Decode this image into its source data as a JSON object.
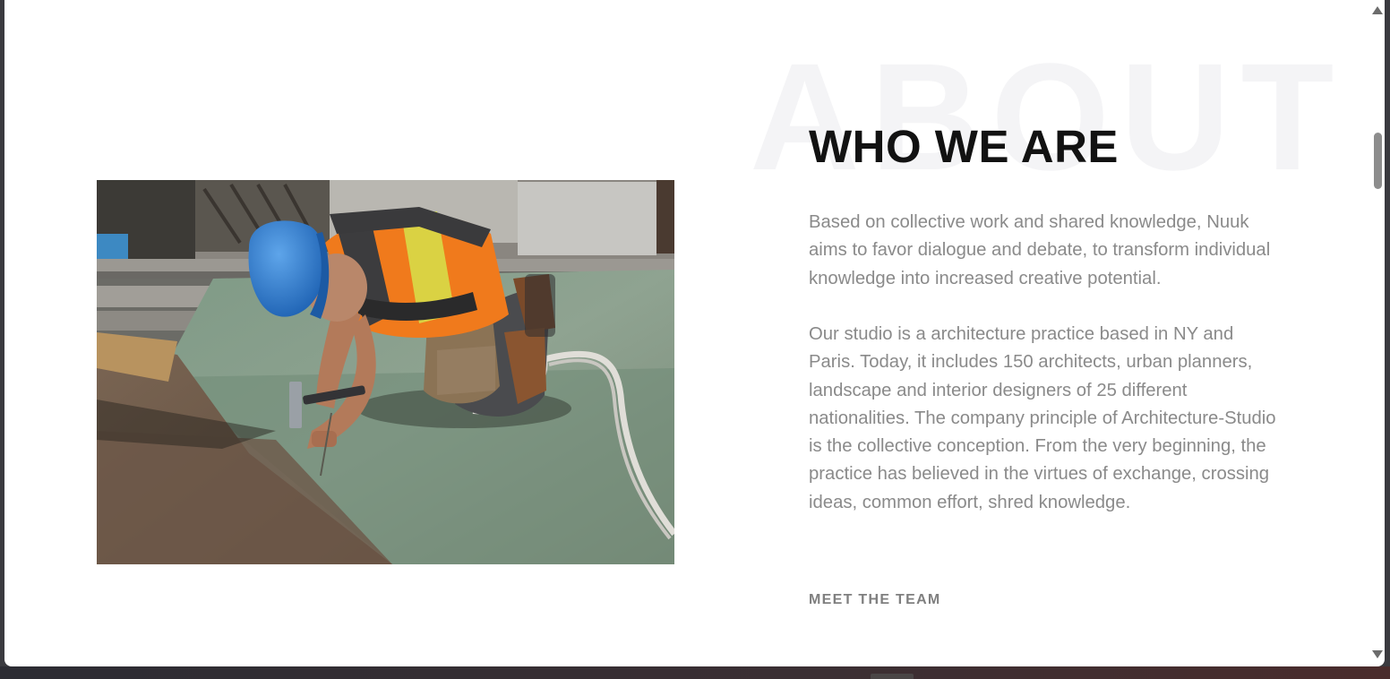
{
  "about": {
    "watermark": "ABOUT",
    "heading": "WHO WE ARE",
    "paragraphs": [
      "Based on collective work and shared knowledge, Nuuk aims to favor dialogue and debate, to transform individual knowledge into increased creative potential.",
      "Our studio is a architecture practice based in NY and Paris. Today, it includes 150 architects, urban planners, landscape and interior designers of 25 different nationalities. The company principle of Architecture-Studio is the collective conception. From the very beginning, the practice has believed in the virtues of exchange, crossing ideas, common effort, shred knowledge."
    ],
    "cta_label": "MEET THE TEAM"
  },
  "photo": {
    "subject": "construction worker in blue hard hat and orange safety vest hammering on a roof deck"
  },
  "scrollbar": {
    "up_icon": "triangle-up",
    "down_icon": "triangle-down"
  },
  "colors": {
    "heading": "#121212",
    "body_text": "#8a8a8a",
    "watermark": "#f4f4f6",
    "cta": "#7f7f7f",
    "hard_hat": "#2f7fd0",
    "vest": "#f07a1c"
  }
}
